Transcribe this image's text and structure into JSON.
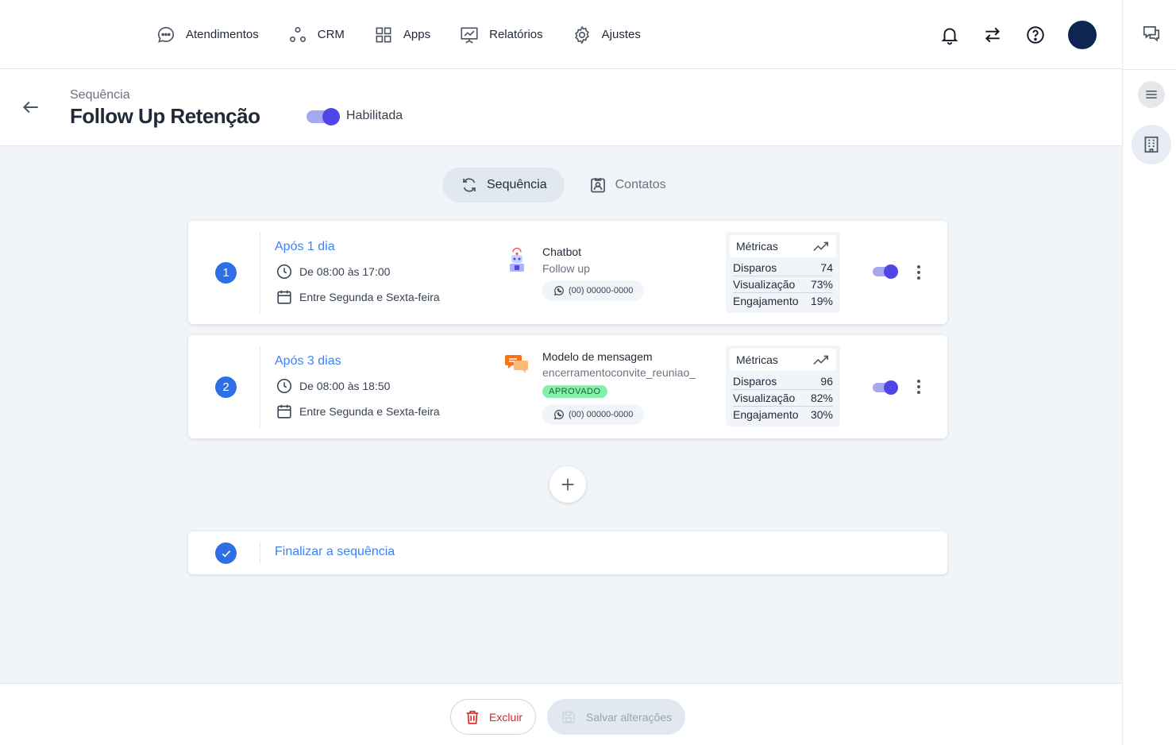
{
  "nav": {
    "items": [
      {
        "label": "Atendimentos",
        "icon": "chat-bubble-icon"
      },
      {
        "label": "CRM",
        "icon": "crm-nodes-icon"
      },
      {
        "label": "Apps",
        "icon": "grid-icon"
      },
      {
        "label": "Relatórios",
        "icon": "presentation-chart-icon"
      },
      {
        "label": "Ajustes",
        "icon": "gear-icon"
      }
    ]
  },
  "header": {
    "breadcrumb": "Sequência",
    "title": "Follow Up Retenção",
    "enabled_label": "Habilitada",
    "enabled": true
  },
  "tabs": [
    {
      "label": "Sequência",
      "active": true
    },
    {
      "label": "Contatos",
      "active": false
    }
  ],
  "steps": [
    {
      "number": "1",
      "delay": "Após 1 dia",
      "hours": "De 08:00 às 17:00",
      "days": "Entre Segunda e Sexta-feira",
      "action_title": "Chatbot",
      "action_sub": "Follow up",
      "phone": "(00) 00000-0000",
      "metrics": {
        "title": "Métricas",
        "rows": [
          {
            "label": "Disparos",
            "value": "74"
          },
          {
            "label": "Visualização",
            "value": "73%"
          },
          {
            "label": "Engajamento",
            "value": "19%"
          }
        ]
      },
      "enabled": true
    },
    {
      "number": "2",
      "delay": "Após 3 dias",
      "hours": "De 08:00 às 18:50",
      "days": "Entre Segunda e Sexta-feira",
      "action_title": "Modelo de mensagem",
      "action_sub": "encerramentoconvite_reuniao_",
      "status": "APROVADO",
      "phone": "(00) 00000-0000",
      "metrics": {
        "title": "Métricas",
        "rows": [
          {
            "label": "Disparos",
            "value": "96"
          },
          {
            "label": "Visualização",
            "value": "82%"
          },
          {
            "label": "Engajamento",
            "value": "30%"
          }
        ]
      },
      "enabled": true
    }
  ],
  "finalize_label": "Finalizar a sequência",
  "footer": {
    "delete_label": "Excluir",
    "save_label": "Salvar alterações"
  },
  "colors": {
    "accent": "#4f46e5",
    "step_blue": "#2f6fe4",
    "link_blue": "#3b82f6",
    "danger": "#dc2626",
    "approved_bg": "#86efac",
    "avatar": "#0e2452"
  }
}
